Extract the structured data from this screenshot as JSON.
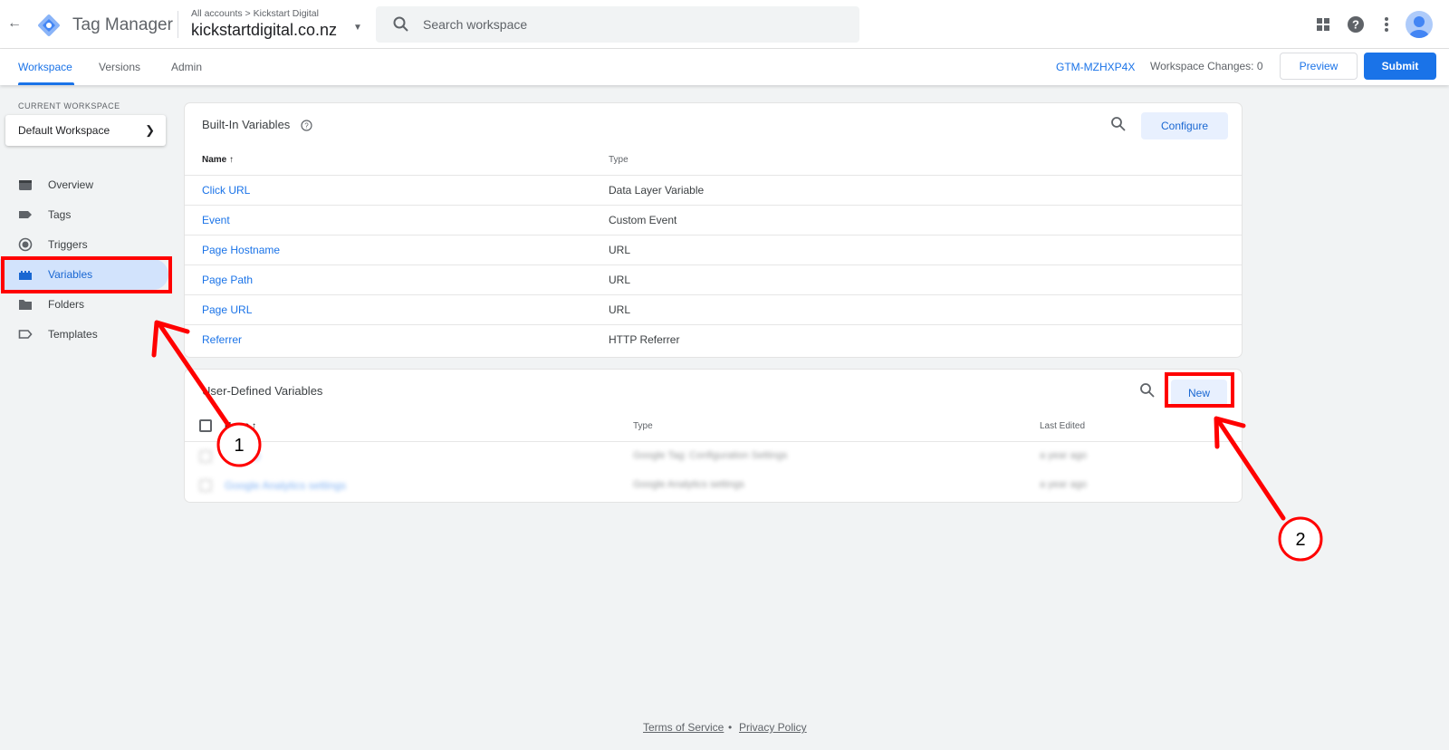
{
  "topbar": {
    "app_title": "Tag Manager",
    "breadcrumb_accounts": "All accounts",
    "breadcrumb_sep": ">",
    "breadcrumb_account": "Kickstart Digital",
    "container_name": "kickstartdigital.co.nz",
    "search_placeholder": "Search workspace"
  },
  "subnav": {
    "tabs": [
      {
        "label": "Workspace"
      },
      {
        "label": "Versions"
      },
      {
        "label": "Admin"
      }
    ],
    "container_id": "GTM-MZHXP4X",
    "workspace_changes": "Workspace Changes: 0",
    "preview_label": "Preview",
    "submit_label": "Submit"
  },
  "sidebar": {
    "current_workspace_label": "CURRENT WORKSPACE",
    "workspace_name": "Default Workspace",
    "items": [
      {
        "label": "Overview",
        "icon": "overview-icon"
      },
      {
        "label": "Tags",
        "icon": "tag-icon"
      },
      {
        "label": "Triggers",
        "icon": "trigger-icon"
      },
      {
        "label": "Variables",
        "icon": "variables-icon"
      },
      {
        "label": "Folders",
        "icon": "folder-icon"
      },
      {
        "label": "Templates",
        "icon": "template-icon"
      }
    ]
  },
  "builtin": {
    "title": "Built-In Variables",
    "configure_label": "Configure",
    "col_name": "Name",
    "col_type": "Type",
    "rows": [
      {
        "name": "Click URL",
        "type": "Data Layer Variable"
      },
      {
        "name": "Event",
        "type": "Custom Event"
      },
      {
        "name": "Page Hostname",
        "type": "URL"
      },
      {
        "name": "Page Path",
        "type": "URL"
      },
      {
        "name": "Page URL",
        "type": "URL"
      },
      {
        "name": "Referrer",
        "type": "HTTP Referrer"
      }
    ]
  },
  "userdefined": {
    "title": "User-Defined Variables",
    "new_label": "New",
    "col_name": "Name",
    "col_type": "Type",
    "col_edited": "Last Edited",
    "rows": [
      {
        "name": "GA4 ID",
        "type": "Google Tag: Configuration Settings",
        "edited": "a year ago"
      },
      {
        "name": "Google Analytics settings",
        "type": "Google Analytics settings",
        "edited": "a year ago"
      }
    ]
  },
  "footer": {
    "terms": "Terms of Service",
    "dot": "•",
    "privacy": "Privacy Policy"
  },
  "annotations": {
    "step1": "1",
    "step2": "2",
    "color": "#ff0000"
  },
  "colors": {
    "accent": "#1a73e8",
    "active_nav_bg": "#d2e3fc"
  }
}
